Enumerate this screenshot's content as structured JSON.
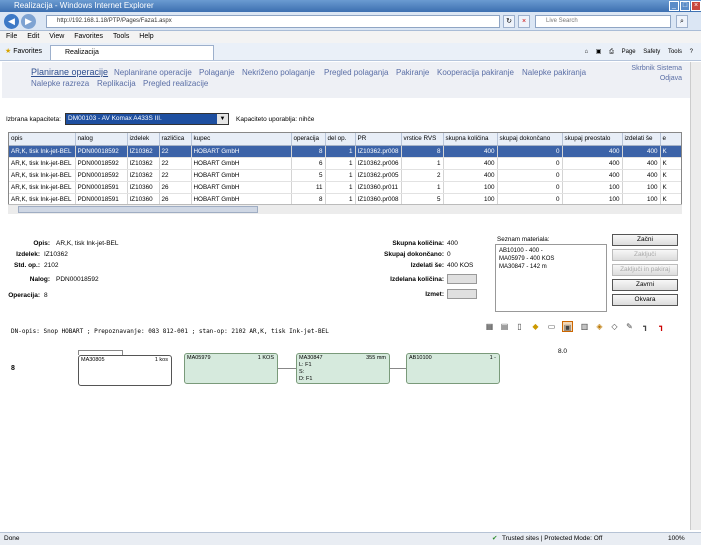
{
  "window": {
    "title": "Realizacija - Windows Internet Explorer"
  },
  "browser": {
    "url": "http://192.168.1.18/PTP/Pages/Faza1.aspx",
    "search_placeholder": "Live Search",
    "tab_title": "Realizacija",
    "favorites_label": "Favorites",
    "menu": [
      "File",
      "Edit",
      "View",
      "Favorites",
      "Tools",
      "Help"
    ],
    "commands": [
      "Page",
      "Safety",
      "Tools"
    ]
  },
  "nav": {
    "row1": [
      "Planirane operacije",
      "Neplanirane operacije",
      "Polaganje",
      "Nekriženo polaganje",
      "Pregled polaganja",
      "Pakiranje",
      "Kooperacija pakiranje",
      "Nalepke pakiranja"
    ],
    "row2": [
      "Nalepke razreza",
      "Replikacija",
      "Pregled realizacije"
    ],
    "right": [
      "Skrbnik Sistema",
      "Odjava"
    ]
  },
  "capacity": {
    "label": "Izbrana kapaciteta:",
    "selected": "DM00103 - AV Komax A433S III.",
    "note": "Kapaciteto uporablja: nihče"
  },
  "table": {
    "headers": [
      "opis",
      "nalog",
      "izdelek",
      "različica",
      "kupec",
      "operacija",
      "del op.",
      "PR",
      "vrstice RVS",
      "skupna količina",
      "skupaj dokončano",
      "skupaj preostalo",
      "izdelati še",
      "e"
    ],
    "rows": [
      [
        "AR,K, tisk Ink-jet-BEL",
        "PDN00018592",
        "IZ10362",
        "22",
        "HOBART GmbH",
        "8",
        "1",
        "IZ10362.pr008",
        "8",
        "400",
        "0",
        "400",
        "400",
        "K"
      ],
      [
        "AR,K, tisk Ink-jet-BEL",
        "PDN00018592",
        "IZ10362",
        "22",
        "HOBART GmbH",
        "6",
        "1",
        "IZ10362.pr006",
        "1",
        "400",
        "0",
        "400",
        "400",
        "K"
      ],
      [
        "AR,K, tisk Ink-jet-BEL",
        "PDN00018592",
        "IZ10362",
        "22",
        "HOBART GmbH",
        "5",
        "1",
        "IZ10362.pr005",
        "2",
        "400",
        "0",
        "400",
        "400",
        "K"
      ],
      [
        "AR,K, tisk Ink-jet-BEL",
        "PDN00018591",
        "IZ10360",
        "26",
        "HOBART GmbH",
        "11",
        "1",
        "IZ10360.pr011",
        "1",
        "100",
        "0",
        "100",
        "100",
        "K"
      ],
      [
        "AR,K, tisk Ink-jet-BEL",
        "PDN00018591",
        "IZ10360",
        "26",
        "HOBART GmbH",
        "8",
        "1",
        "IZ10360.pr008",
        "5",
        "100",
        "0",
        "100",
        "100",
        "K"
      ]
    ]
  },
  "details": {
    "opis_label": "Opis:",
    "opis": "AR,K, tisk Ink-jet-BEL",
    "izdelek_label": "Izdelek:",
    "izdelek": "IZ10362",
    "stdop_label": "Std. op.:",
    "stdop": "2102",
    "nalog_label": "Nalog:",
    "nalog": "PDN00018592",
    "operacija_label": "Operacija:",
    "operacija": "8",
    "skupna_label": "Skupna količina:",
    "skupna": "400",
    "skupaj_label": "Skupaj dokončano:",
    "skupaj": "0",
    "izdelati_label": "Izdelati še:",
    "izdelati": "400 KOS",
    "izdelana_label": "Izdelana količina:",
    "izmet_label": "Izmet:"
  },
  "materials": {
    "label": "Seznam materiala:",
    "items": [
      "AB10100 - 400 -",
      "MA05979 - 400 KOS",
      "MA30847 - 142 m"
    ]
  },
  "actions": [
    "Začni",
    "Zaključi",
    "Zaključi in pakiraj",
    "Zavrni",
    "Okvara"
  ],
  "dn_opis": "DN-opis: Snop HOBART ; Prepoznavanje: 083 812-001 ; stan-op: 2102 AR,K, tisk Ink-jet-BEL",
  "graph": {
    "row_label": "8",
    "right_label": "8.0",
    "nodes": [
      {
        "code": "MA30805",
        "qty": "1 kos",
        "lines": []
      },
      {
        "code": "MA05979",
        "qty": "1 KOS",
        "lines": []
      },
      {
        "code": "MA30847",
        "qty": "355 mm",
        "lines": [
          "L: F1",
          "S:",
          "D: F1"
        ]
      },
      {
        "code": "AB10100",
        "qty": "1 -",
        "lines": []
      }
    ]
  },
  "status": {
    "left": "Done",
    "zone": "Trusted sites | Protected Mode: Off",
    "zoom": "100%"
  }
}
